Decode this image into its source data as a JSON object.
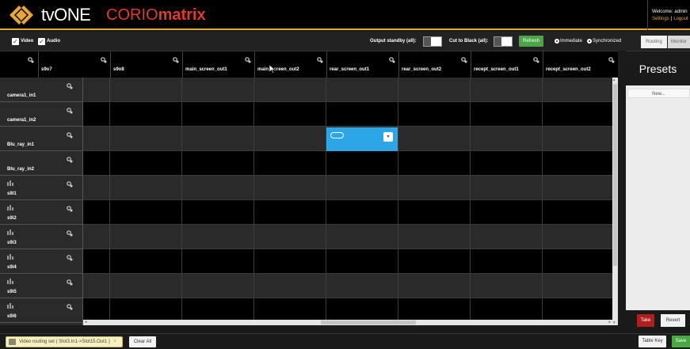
{
  "header": {
    "brand": "tvONE",
    "product_prefix": "CORIO",
    "product_suffix": "matrix",
    "welcome": "Welcome: admin",
    "settings_link": "Settings",
    "link_separator": "|",
    "logout_link": "Logout"
  },
  "toolbar": {
    "video_label": "Video",
    "audio_label": "Audio",
    "output_standby_label": "Output standby (all):",
    "cut_to_black_label": "Cut to Black (all):",
    "refresh_label": "Refresh",
    "immediate_label": "Immediate",
    "synchronized_label": "Synchronized",
    "routing_tab": "Routing",
    "monitor_tab": "Monitor"
  },
  "columns": [
    "s9o7",
    "s9o8",
    "main_screen_out1",
    "main_screen_out2",
    "rear_screen_out1",
    "rear_screen_out2",
    "recept_screen_out1",
    "recept_screen_out2"
  ],
  "rows": [
    {
      "label": "camera1_in1",
      "type": "video"
    },
    {
      "label": "camera1_in2",
      "type": "video"
    },
    {
      "label": "Blu_ray_in1",
      "type": "video"
    },
    {
      "label": "Blu_ray_in2",
      "type": "video"
    },
    {
      "label": "s9i1",
      "type": "audio"
    },
    {
      "label": "s9i2",
      "type": "audio"
    },
    {
      "label": "s9i3",
      "type": "audio"
    },
    {
      "label": "s9i4",
      "type": "audio"
    },
    {
      "label": "s9i5",
      "type": "audio"
    },
    {
      "label": "s9i6",
      "type": "audio"
    }
  ],
  "active_route": {
    "row": "Blu_ray_in1",
    "column": "rear_screen_out1",
    "color": "#2da6e8"
  },
  "presets": {
    "title": "Presets",
    "new_label": "New...",
    "take_label": "Take",
    "revert_label": "Revert"
  },
  "footer": {
    "notice": "Video routing set ( Slot3.In1->Slot15.Out1 )",
    "notice_close": "×",
    "clear_all_label": "Clear All",
    "table_key_label": "Table Key",
    "save_label": "Save"
  },
  "colors": {
    "accent": "#e8a53a",
    "product_red": "#e03a2f",
    "refresh_green": "#4aa844",
    "take_red": "#b01e1e",
    "active_cell": "#2da6e8"
  }
}
